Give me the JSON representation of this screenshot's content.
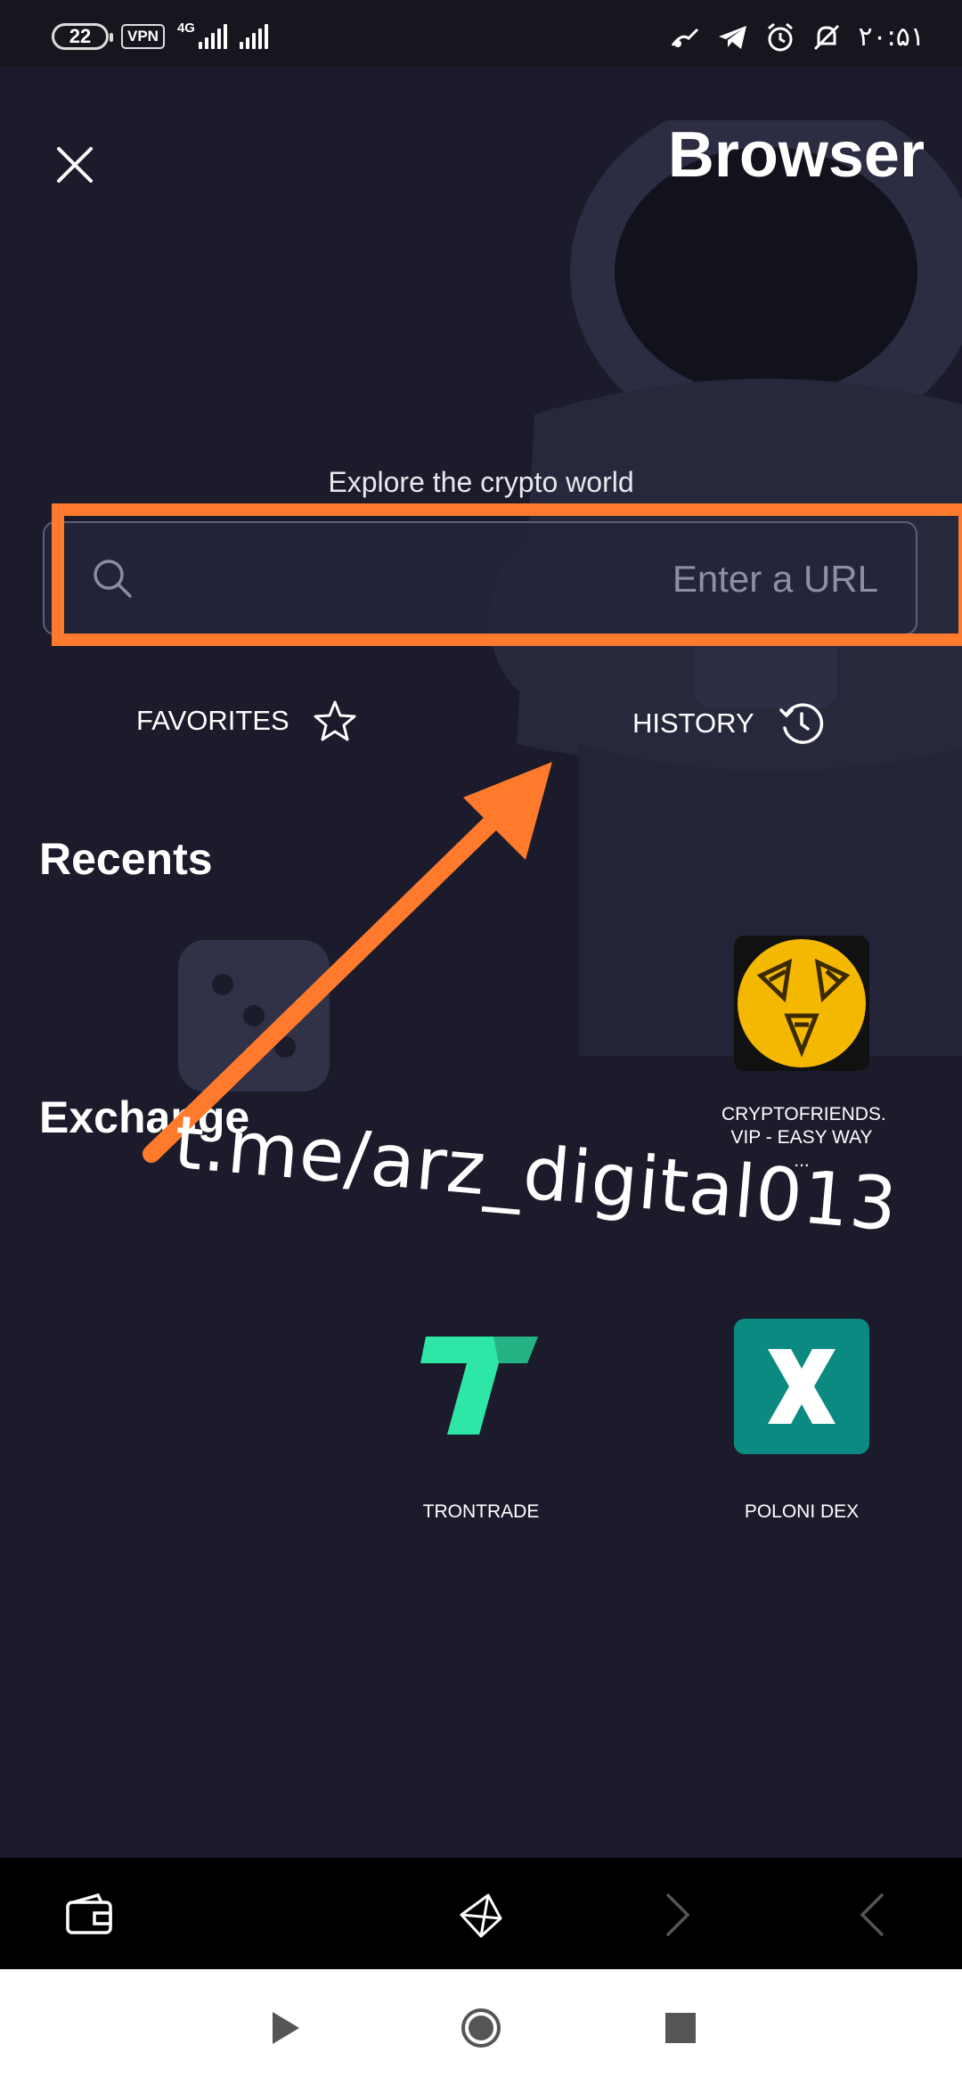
{
  "status_bar": {
    "battery": "22",
    "vpn": "VPN",
    "network": "4G",
    "time": "۲۰:۵۱"
  },
  "header": {
    "title": "Browser",
    "close_icon": "close-icon"
  },
  "search": {
    "heading": "Explore the crypto world",
    "placeholder": "Enter a URL",
    "value": ""
  },
  "quick_links": {
    "favorites": "FAVORITES",
    "history": "HISTORY"
  },
  "recents": {
    "title": "Recents",
    "items": [
      {
        "label": "CRYPTOFRIENDS. VIP - EASY WAY ..."
      }
    ]
  },
  "exchange": {
    "title": "Exchange",
    "items": [
      {
        "label": "TRONTRADE"
      },
      {
        "label": "POLONI DEX"
      }
    ]
  },
  "annotation": {
    "watermark": "t.me/arz_digital013",
    "color": "#ff7a2c"
  },
  "bottom_nav": [
    "wallet-icon",
    "dapp-browser-icon",
    "forward-icon",
    "back-icon"
  ],
  "system_nav": [
    "play-icon",
    "home-circle-icon",
    "stop-square-icon"
  ]
}
